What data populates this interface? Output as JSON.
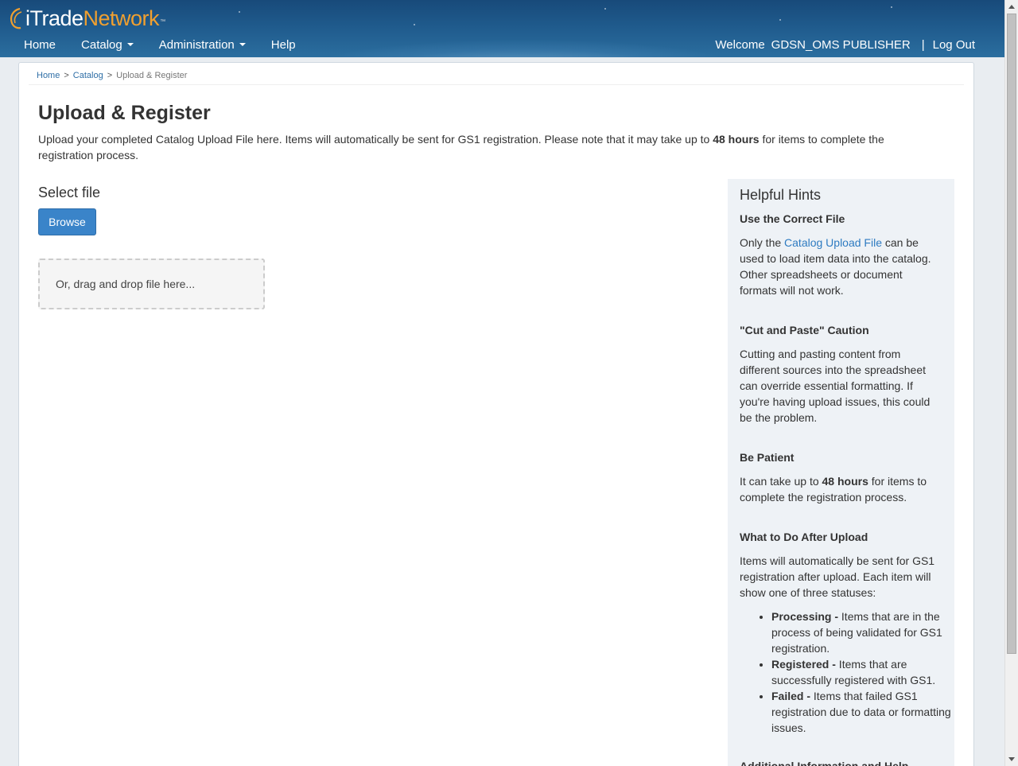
{
  "brand": {
    "i": "i",
    "trade": "Trade",
    "network": "Network",
    "tm": "™"
  },
  "nav": {
    "home": "Home",
    "catalog": "Catalog",
    "administration": "Administration",
    "help": "Help"
  },
  "user": {
    "welcome": "Welcome",
    "name": "GDSN_OMS PUBLISHER",
    "separator": "|",
    "logout": "Log Out"
  },
  "breadcrumb": {
    "home": "Home",
    "catalog": "Catalog",
    "current": "Upload & Register",
    "sep": ">"
  },
  "page": {
    "title": "Upload & Register",
    "intro_1": "Upload your completed Catalog Upload File here. Items will automatically be sent for GS1 registration. Please note that it may take up to ",
    "intro_bold": "48 hours",
    "intro_2": " for items to complete the registration process.",
    "select_file": "Select file",
    "browse": "Browse",
    "dropzone": "Or, drag and drop file here..."
  },
  "hints": {
    "title": "Helpful Hints",
    "correct_file_title": "Use the Correct File",
    "correct_file_1": "Only the ",
    "correct_file_link": "Catalog Upload File",
    "correct_file_2": " can be used to load item data into the catalog. Other spreadsheets or document formats will not work.",
    "cut_paste_title": "\"Cut and Paste\" Caution",
    "cut_paste_body": "Cutting and pasting content from different sources into the spreadsheet can override essential formatting. If you're having upload issues, this could be the problem.",
    "patient_title": "Be Patient",
    "patient_1": "It can take up to ",
    "patient_bold": "48 hours",
    "patient_2": " for items to complete the registration process.",
    "after_title": "What to Do After Upload",
    "after_body": "Items will automatically be sent for GS1 registration after upload. Each item will show one of three statuses:",
    "statuses": [
      {
        "label": "Processing -",
        "desc": " Items that are in the process of being validated for GS1 registration."
      },
      {
        "label": "Registered -",
        "desc": " Items that are successfully registered with GS1."
      },
      {
        "label": "Failed -",
        "desc": " Items that failed GS1 registration due to data or formatting issues."
      }
    ],
    "more_title": "Additional Information and Help"
  }
}
